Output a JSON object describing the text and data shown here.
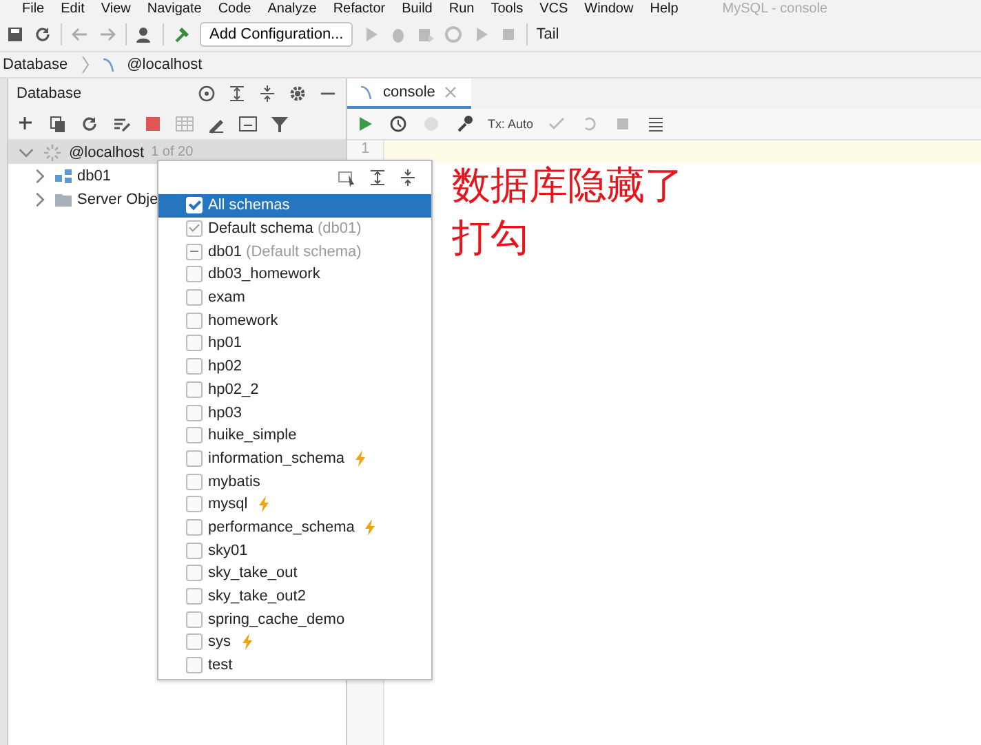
{
  "menu": [
    "File",
    "Edit",
    "View",
    "Navigate",
    "Code",
    "Analyze",
    "Refactor",
    "Build",
    "Run",
    "Tools",
    "VCS",
    "Window",
    "Help"
  ],
  "window": {
    "title": "MySQL - console"
  },
  "toolbar": {
    "config_button": "Add Configuration...",
    "tail": "Tail"
  },
  "breadcrumb": [
    "Database",
    "@localhost"
  ],
  "database_panel": {
    "title": "Database",
    "tree": [
      {
        "label": "@localhost",
        "count": "1 of 20",
        "expanded": true,
        "children": [
          {
            "label": "db01",
            "kind": "schema",
            "expanded": false
          },
          {
            "label": "Server Obje",
            "kind": "folder",
            "expanded": false
          }
        ]
      }
    ]
  },
  "editor": {
    "tab": "console",
    "tx": "Tx: Auto",
    "line_numbers": [
      "1"
    ]
  },
  "schema_popup": {
    "items": [
      {
        "label": "All schemas",
        "checked": true,
        "selected": true
      },
      {
        "label": "Default schema",
        "note": "(db01)",
        "checked": true,
        "disabled": true,
        "selected": false
      },
      {
        "label": "db01",
        "note": "(Default schema)",
        "indeterminate": true,
        "selected": false
      },
      {
        "label": "db03_homework",
        "checked": false,
        "selected": false
      },
      {
        "label": "exam",
        "checked": false,
        "selected": false
      },
      {
        "label": "homework",
        "checked": false,
        "selected": false
      },
      {
        "label": "hp01",
        "checked": false,
        "selected": false
      },
      {
        "label": "hp02",
        "checked": false,
        "selected": false
      },
      {
        "label": "hp02_2",
        "checked": false,
        "selected": false
      },
      {
        "label": "hp03",
        "checked": false,
        "selected": false
      },
      {
        "label": "huike_simple",
        "checked": false,
        "selected": false
      },
      {
        "label": "information_schema",
        "checked": false,
        "selected": false,
        "system": true
      },
      {
        "label": "mybatis",
        "checked": false,
        "selected": false
      },
      {
        "label": "mysql",
        "checked": false,
        "selected": false,
        "system": true
      },
      {
        "label": "performance_schema",
        "checked": false,
        "selected": false,
        "system": true
      },
      {
        "label": "sky01",
        "checked": false,
        "selected": false
      },
      {
        "label": "sky_take_out",
        "checked": false,
        "selected": false
      },
      {
        "label": "sky_take_out2",
        "checked": false,
        "selected": false
      },
      {
        "label": "spring_cache_demo",
        "checked": false,
        "selected": false
      },
      {
        "label": "sys",
        "checked": false,
        "selected": false,
        "system": true
      },
      {
        "label": "test",
        "checked": false,
        "selected": false
      }
    ]
  },
  "annotation": [
    "数据库隐藏了",
    "打勾"
  ]
}
